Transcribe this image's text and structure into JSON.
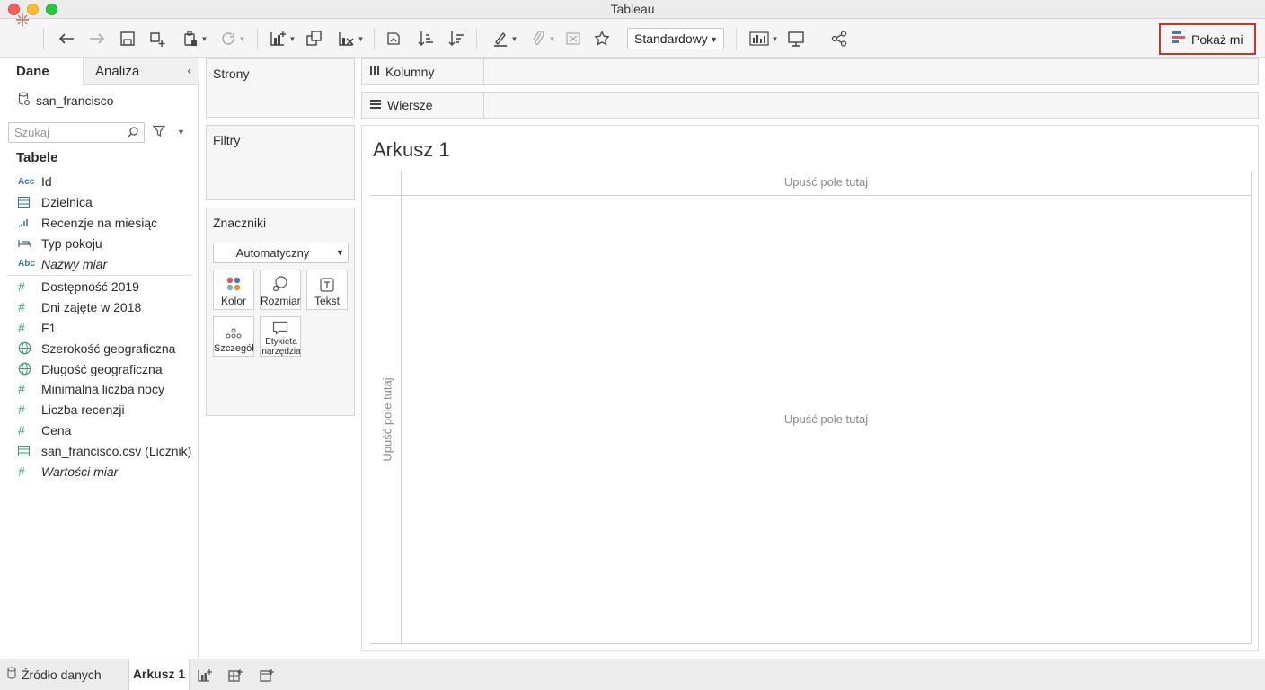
{
  "window": {
    "title": "Tableau"
  },
  "toolbar": {
    "icons": [
      "tableau-logo-icon",
      "undo-icon",
      "redo-icon",
      "save-icon",
      "new-datasource-icon",
      "pause-update-icon",
      "refresh-icon",
      "new-worksheet-icon",
      "duplicate-sheet-icon",
      "clear-sheet-icon",
      "swap-icon",
      "sort-ascending-icon",
      "sort-descending-icon",
      "highlight-icon",
      "group-icon",
      "label-icon",
      "fix-axes-icon",
      "fit-icon",
      "presentation-icon",
      "share-icon"
    ],
    "fit_dropdown": "Standardowy",
    "show_me_label": "Pokaż mi"
  },
  "datapane": {
    "tab_data": "Dane",
    "tab_analytics": "Analiza",
    "collapse": "‹",
    "datasource": "san_francisco",
    "search_placeholder": "Szukaj",
    "tables_header": "Tabele",
    "dimensions": [
      {
        "icon": "Acc",
        "type": "string",
        "label": "Id",
        "italic": false
      },
      {
        "icon": "table-icon",
        "type": "table",
        "label": "Dzielnica",
        "italic": false
      },
      {
        "icon": "bin-icon",
        "type": "bin",
        "label": "Recenzje na miesiąc",
        "italic": false
      },
      {
        "icon": "bed-icon",
        "type": "string",
        "label": "Typ pokoju",
        "italic": false
      },
      {
        "icon": "Abc",
        "type": "string",
        "label": "Nazwy miar",
        "italic": true
      }
    ],
    "measures": [
      {
        "icon": "#",
        "type": "number",
        "label": "Dostępność 2019",
        "italic": false
      },
      {
        "icon": "#",
        "type": "number",
        "label": "Dni zajęte w 2018",
        "italic": false
      },
      {
        "icon": "#",
        "type": "number",
        "label": "F1",
        "italic": false
      },
      {
        "icon": "globe-icon",
        "type": "geo",
        "label": "Szerokość geograficzna",
        "italic": false
      },
      {
        "icon": "globe-icon",
        "type": "geo",
        "label": "Długość geograficzna",
        "italic": false
      },
      {
        "icon": "#",
        "type": "number",
        "label": "Minimalna liczba nocy",
        "italic": false
      },
      {
        "icon": "#",
        "type": "number",
        "label": "Liczba recenzji",
        "italic": false
      },
      {
        "icon": "#",
        "type": "number",
        "label": "Cena",
        "italic": false
      },
      {
        "icon": "table-icon",
        "type": "table",
        "label": "san_francisco.csv (Licznik)",
        "italic": false
      },
      {
        "icon": "#",
        "type": "number",
        "label": "Wartości miar",
        "italic": true
      }
    ]
  },
  "cards": {
    "pages": "Strony",
    "filters": "Filtry",
    "marks": "Znaczniki",
    "mark_type": "Automatyczny",
    "mark_buttons": [
      "Kolor",
      "Rozmiar",
      "Tekst",
      "Szczegół",
      "Etykieta narzędzia"
    ]
  },
  "shelves": {
    "columns": "Kolumny",
    "rows": "Wiersze"
  },
  "canvas": {
    "sheet_title": "Arkusz 1",
    "drop_top": "Upuść pole tutaj",
    "drop_center": "Upuść pole tutaj",
    "drop_left": "Upuść pole tutaj"
  },
  "bottom": {
    "data_source_tab": "Źródło danych",
    "sheet_tab": "Arkusz 1"
  },
  "colors": {
    "accent_red": "#c0392b",
    "measure_green": "#3c9c74",
    "dimension_blue": "#3f6fa0"
  }
}
